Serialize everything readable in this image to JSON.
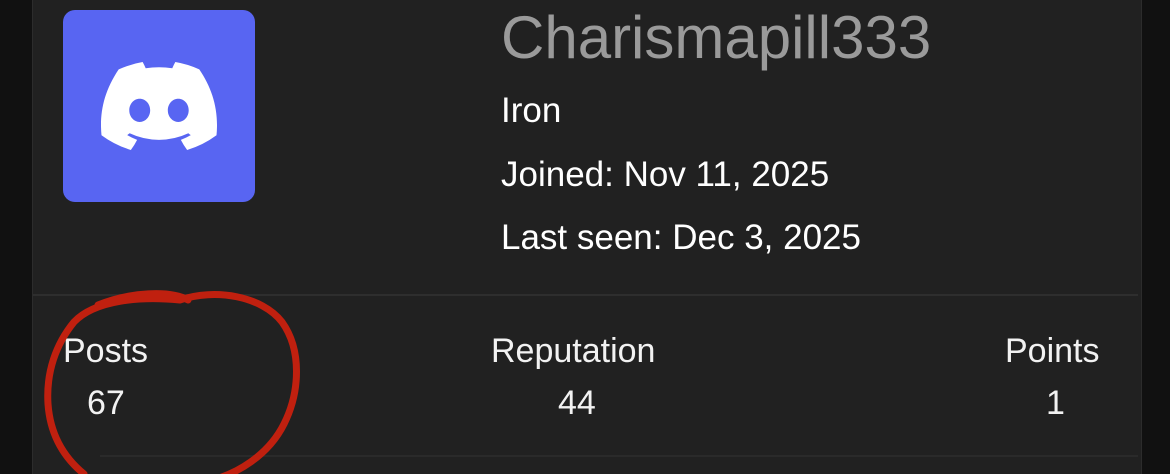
{
  "profile": {
    "username": "Charismapill333",
    "rank": "Iron",
    "joined": "Joined: Nov 11, 2025",
    "last_seen": "Last seen: Dec 3, 2025",
    "avatar_icon": "discord-logo-icon"
  },
  "stats": {
    "posts_label": "Posts",
    "posts_value": "67",
    "reputation_label": "Reputation",
    "reputation_value": "44",
    "points_label": "Points",
    "points_value": "1"
  },
  "colors": {
    "background": "#111111",
    "card": "#212121",
    "avatar": "#5865F2",
    "username": "#9a9a9a",
    "annotation": "#c0200f"
  }
}
